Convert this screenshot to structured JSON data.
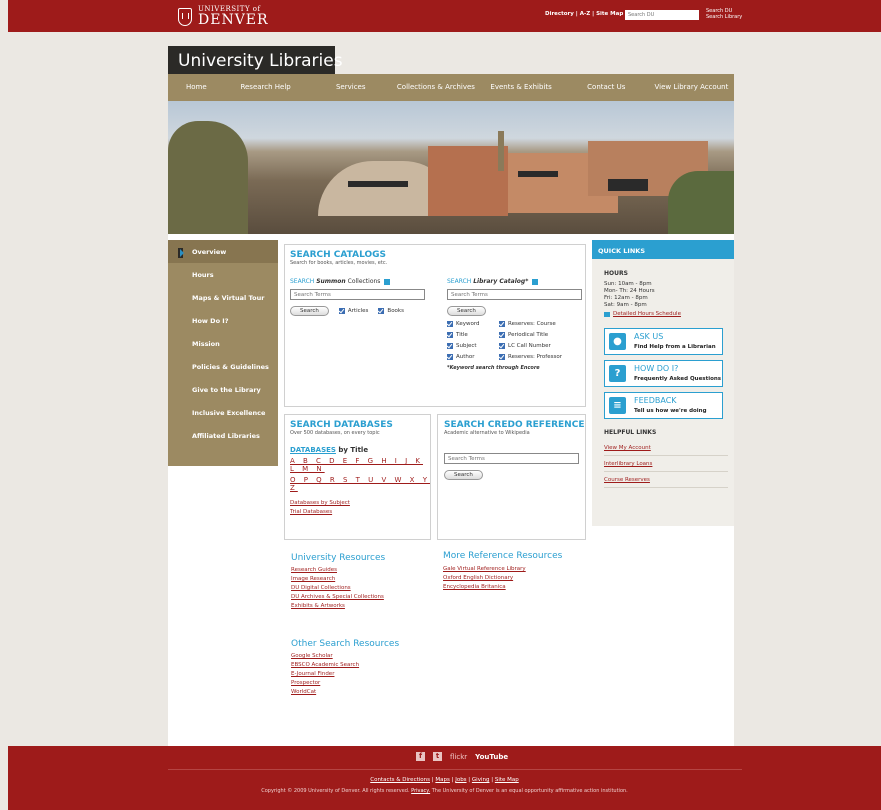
{
  "header": {
    "logo_line1": "UNIVERSITY of",
    "logo_line2": "DENVER",
    "links": "Directory | A-Z | Site Map",
    "search_placeholder": "Search DU",
    "search_opt1": "Search DU",
    "search_opt2": "Search Library"
  },
  "site_title": "University Libraries",
  "nav": [
    "Home",
    "Research Help",
    "Services",
    "Collections & Archives",
    "Events & Exhibits",
    "Contact Us",
    "View Library Account"
  ],
  "sidebar": [
    "Overview",
    "Hours",
    "Maps & Virtual Tour",
    "How Do I?",
    "Mission",
    "Policies & Guidelines",
    "Give to the Library",
    "Inclusive Excellence",
    "Affiliated Libraries"
  ],
  "catalogs": {
    "title": "SEARCH CATALOGS",
    "subtitle": "Search for books, articles, movies, etc.",
    "summon_prefix": "SEARCH",
    "summon_name": "Summon",
    "summon_suffix": "Collections",
    "summon_placeholder": "Search Terms",
    "search_button": "Search",
    "summon_checks": [
      "Articles",
      "Books"
    ],
    "catalog_prefix": "SEARCH",
    "catalog_name": "Library Catalog*",
    "catalog_placeholder": "Search Terms",
    "catalog_checks_left": [
      "Keyword",
      "Title",
      "Subject",
      "Author"
    ],
    "catalog_checks_right": [
      "Reserves: Course",
      "Periodical Title",
      "LC Call Number",
      "Reserves: Professor"
    ],
    "note": "*Keyword search through Encore"
  },
  "databases": {
    "title": "SEARCH DATABASES",
    "subtitle": "Over 500 databases, on every topic",
    "by_title_a": "DATABASES",
    "by_title_b": "by Title",
    "letters1": "A B C D E F G H I J K L M N",
    "letters2": "O P Q R S T U V W X Y Z",
    "links": [
      "Databases by Subject",
      "Trial Databases"
    ]
  },
  "credo": {
    "title": "SEARCH CREDO REFERENCE",
    "subtitle": "Academic alternative to Wikipedia",
    "placeholder": "Search Terms",
    "button": "Search"
  },
  "university_resources": {
    "title": "University Resources",
    "links": [
      "Research Guides",
      "Image Research",
      "DU Digital Collections",
      "DU Archives & Special Collections",
      "Exhibits & Artworks"
    ]
  },
  "more_reference": {
    "title": "More Reference Resources",
    "links": [
      "Gale Virtual Reference Library",
      "Oxford English Dictionary",
      "Encyclopedia Britanica"
    ]
  },
  "other_search": {
    "title": "Other Search Resources",
    "links": [
      "Google Scholar",
      "EBSCO Academic Search",
      "E-Journal Finder",
      "Prospector",
      "WorldCat"
    ]
  },
  "quick_links": {
    "title": "QUICK LINKS",
    "hours_title": "HOURS",
    "hours": [
      "Sun: 10am - 8pm",
      "Mon- Th: 24 Hours",
      "Fri: 12am - 8pm",
      "Sat: 9am - 8pm"
    ],
    "schedule_link": "Detailed Hours Schedule",
    "ask_title": "ASK US",
    "ask_sub": "Find Help from a Librarian",
    "how_title": "HOW DO I?",
    "how_sub": "Frequently Asked Questions",
    "feedback_title": "FEEDBACK",
    "feedback_sub": "Tell us how we're doing",
    "helpful_title": "HELPFUL LINKS",
    "helpful": [
      "View My Account",
      "Interlibrary Loans",
      "Course Reserves"
    ]
  },
  "footer": {
    "social_flickr": "flickr",
    "social_youtube": "YouTube",
    "links": [
      "Contacts & Directions",
      "Maps",
      "Jobs",
      "Giving",
      "Site Map"
    ],
    "copyright_a": "Copyright © 2009 University of Denver. All rights reserved.",
    "privacy": "Privacy.",
    "copyright_b": "The University of Denver is an equal opportunity affirmative action institution."
  }
}
